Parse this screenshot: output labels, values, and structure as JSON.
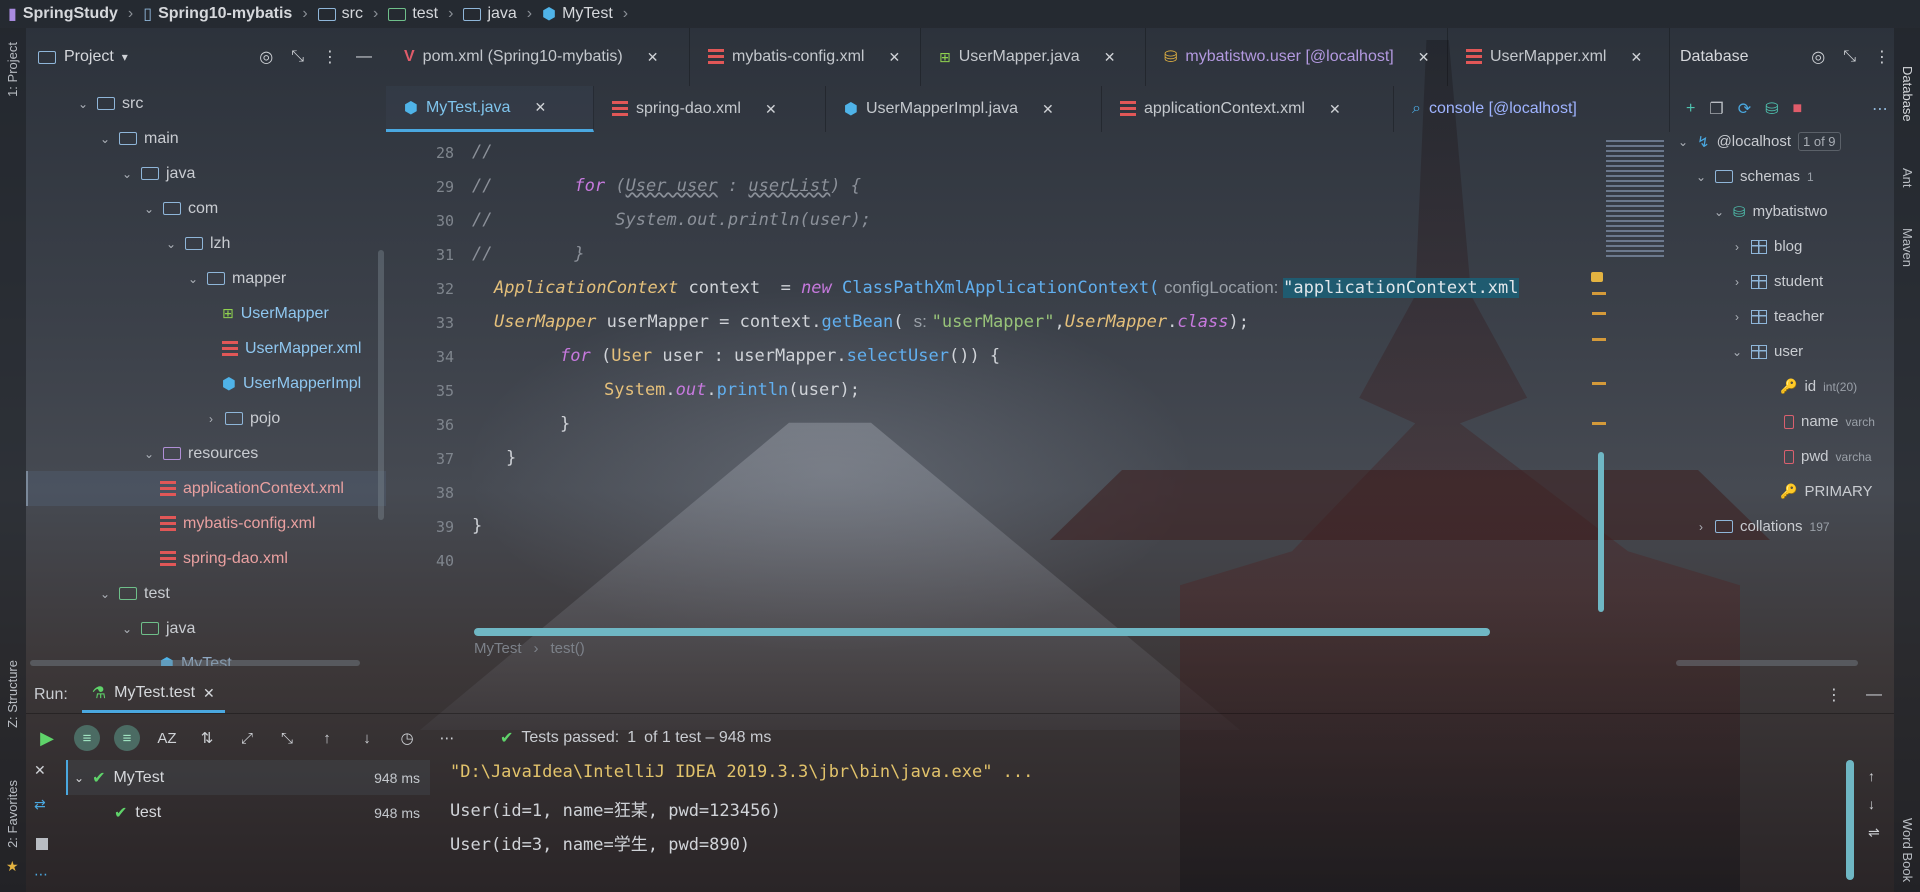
{
  "breadcrumb": {
    "project": "SpringStudy",
    "module": "Spring10-mybatis",
    "src": "src",
    "test": "test",
    "java": "java",
    "file": "MyTest"
  },
  "left_strip": {
    "project": "1: Project",
    "structure": "Z: Structure",
    "favorites": "2: Favorites"
  },
  "right_strip": {
    "database": "Database",
    "ant": "Ant",
    "maven": "Maven",
    "wordbook": "Word Book"
  },
  "project_pane": {
    "title": "Project",
    "tree": [
      {
        "label": "src",
        "kind": "folder"
      },
      {
        "label": "main",
        "kind": "folder"
      },
      {
        "label": "java",
        "kind": "folder-src"
      },
      {
        "label": "com",
        "kind": "folder"
      },
      {
        "label": "lzh",
        "kind": "folder"
      },
      {
        "label": "mapper",
        "kind": "folder"
      },
      {
        "label": "UserMapper",
        "kind": "interface"
      },
      {
        "label": "UserMapper.xml",
        "kind": "xml"
      },
      {
        "label": "UserMapperImpl",
        "kind": "class"
      },
      {
        "label": "pojo",
        "kind": "folder"
      },
      {
        "label": "resources",
        "kind": "folder-res"
      },
      {
        "label": "applicationContext.xml",
        "kind": "xml"
      },
      {
        "label": "mybatis-config.xml",
        "kind": "xml"
      },
      {
        "label": "spring-dao.xml",
        "kind": "xml"
      },
      {
        "label": "test",
        "kind": "folder-test"
      },
      {
        "label": "java",
        "kind": "folder-src"
      },
      {
        "label": "MyTest",
        "kind": "class"
      }
    ]
  },
  "tabs_row1": [
    {
      "label": "pom.xml (Spring10-mybatis)",
      "icon": "maven-icon"
    },
    {
      "label": "mybatis-config.xml",
      "icon": "xml-icon"
    },
    {
      "label": "UserMapper.java",
      "icon": "interface-icon"
    },
    {
      "label": "mybatistwo.user [@localhost]",
      "icon": "db-table-icon"
    },
    {
      "label": "UserMapper.xml",
      "icon": "xml-icon"
    }
  ],
  "tabs_row2": [
    {
      "label": "MyTest.java",
      "icon": "class-icon",
      "active": true
    },
    {
      "label": "spring-dao.xml",
      "icon": "xml-icon"
    },
    {
      "label": "UserMapperImpl.java",
      "icon": "class-icon"
    },
    {
      "label": "applicationContext.xml",
      "icon": "xml-icon"
    },
    {
      "label": "console [@localhost]",
      "icon": "console-icon"
    }
  ],
  "editor": {
    "line_numbers": [
      "28",
      "29",
      "30",
      "31",
      "32",
      "33",
      "34",
      "35",
      "36",
      "37",
      "38",
      "39",
      "40"
    ],
    "lines": {
      "l28": "//",
      "l29_a": "//        ",
      "l29_b": "for",
      "l29_c": " (",
      "l29_d": "User user",
      "l29_e": " : ",
      "l29_f": "userList",
      "l29_g": ") {",
      "l30": "//            System.out.println(user);",
      "l31": "//        }",
      "l32_type": "ApplicationContext",
      "l32_var": " context  = ",
      "l32_new": "new",
      "l32_cls": " ClassPathXmlApplicationContext(",
      "l32_hint": " configLocation: ",
      "l32_str": "\"applicationContext.xml",
      "l33_type": "UserMapper",
      "l33_var": " userMapper = context.",
      "l33_fn": "getBean",
      "l33_open": "( ",
      "l33_hint": "s: ",
      "l33_str": "\"userMapper\"",
      "l33_comma": ",",
      "l33_cls": "UserMapper",
      "l33_dot": ".",
      "l33_kw": "class",
      "l33_end": ");",
      "l34_kw": "for",
      "l34_a": " (",
      "l34_type": "User",
      "l34_b": " user : userMapper.",
      "l34_fn": "selectUser",
      "l34_c": "()) {",
      "l35_cls": "System",
      "l35_a": ".",
      "l35_out": "out",
      "l35_b": ".",
      "l35_fn": "println",
      "l35_c": "(user);",
      "l36": "}",
      "l37": "}",
      "l39": "}"
    },
    "crumbs": [
      "MyTest",
      "test()"
    ]
  },
  "database_pane": {
    "title": "Database",
    "host": "@localhost",
    "host_badge": "1 of 9",
    "schemas_label": "schemas",
    "schemas_count": "1",
    "schema": "mybatistwo",
    "tables": [
      "blog",
      "student",
      "teacher",
      "user"
    ],
    "columns": [
      {
        "name": "id",
        "type": "int(20)",
        "icon": "key"
      },
      {
        "name": "name",
        "type": "varch",
        "icon": "column"
      },
      {
        "name": "pwd",
        "type": "varcha",
        "icon": "column"
      },
      {
        "name": "PRIMARY",
        "type": "",
        "icon": "key"
      }
    ],
    "collations_label": "collations",
    "collations_count": "197"
  },
  "run_panel": {
    "run_label": "Run:",
    "tab_label": "MyTest.test",
    "status_prefix": "Tests passed:",
    "status_count": "1",
    "status_suffix": "of 1 test – 948 ms",
    "tests": [
      {
        "name": "MyTest",
        "duration": "948 ms"
      },
      {
        "name": "test",
        "duration": "948 ms"
      }
    ],
    "console": [
      "\"D:\\JavaIdea\\IntelliJ IDEA 2019.3.3\\jbr\\bin\\java.exe\" ...",
      "User(id=1, name=狂某, pwd=123456)",
      "User(id=3, name=学生, pwd=890)"
    ]
  },
  "colors": {
    "accent": "#4aa8e0",
    "pass": "#5fd36a",
    "keyword": "#c679dd",
    "type": "#e5c07b",
    "string": "#98c379"
  }
}
